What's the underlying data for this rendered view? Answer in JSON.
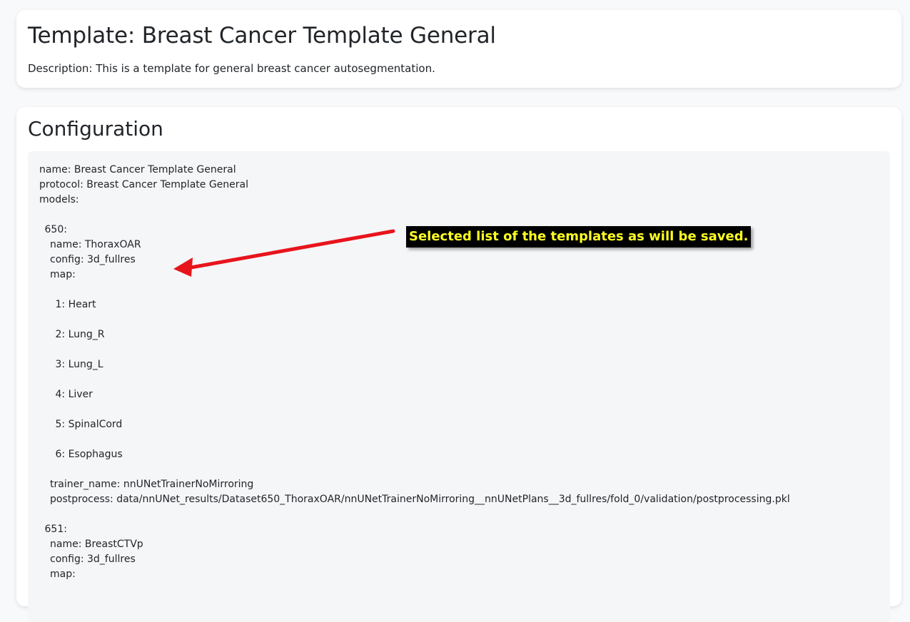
{
  "header": {
    "title": "Template: Breast Cancer Template General",
    "description": "Description: This is a template for general breast cancer autosegmentation."
  },
  "configuration": {
    "heading": "Configuration",
    "lines": [
      {
        "text": "name: Breast Cancer Template General",
        "indent": 0
      },
      {
        "text": "protocol: Breast Cancer Template General",
        "indent": 0
      },
      {
        "text": "models:",
        "indent": 0
      },
      {
        "text": "",
        "indent": 0
      },
      {
        "text": "650:",
        "indent": 1
      },
      {
        "text": "name: ThoraxOAR",
        "indent": 2
      },
      {
        "text": "config: 3d_fullres",
        "indent": 2
      },
      {
        "text": "map:",
        "indent": 2
      },
      {
        "text": "",
        "indent": 0
      },
      {
        "text": "1: Heart",
        "indent": 3
      },
      {
        "text": "",
        "indent": 0
      },
      {
        "text": "2: Lung_R",
        "indent": 3
      },
      {
        "text": "",
        "indent": 0
      },
      {
        "text": "3: Lung_L",
        "indent": 3
      },
      {
        "text": "",
        "indent": 0
      },
      {
        "text": "4: Liver",
        "indent": 3
      },
      {
        "text": "",
        "indent": 0
      },
      {
        "text": "5: SpinalCord",
        "indent": 3
      },
      {
        "text": "",
        "indent": 0
      },
      {
        "text": "6: Esophagus",
        "indent": 3
      },
      {
        "text": "",
        "indent": 0
      },
      {
        "text": "trainer_name: nnUNetTrainerNoMirroring",
        "indent": 2
      },
      {
        "text": "postprocess: data/nnUNet_results/Dataset650_ThoraxOAR/nnUNetTrainerNoMirroring__nnUNetPlans__3d_fullres/fold_0/validation/postprocessing.pkl",
        "indent": 2
      },
      {
        "text": "",
        "indent": 0
      },
      {
        "text": "651:",
        "indent": 1
      },
      {
        "text": "name: BreastCTVp",
        "indent": 2
      },
      {
        "text": "config: 3d_fullres",
        "indent": 2
      },
      {
        "text": "map:",
        "indent": 2
      }
    ]
  },
  "annotation": {
    "callout_text": "Selected list of the templates as will be saved.",
    "arrow_color": "#e8141c",
    "callout_background": "#000000",
    "callout_text_color": "#ffff24"
  }
}
